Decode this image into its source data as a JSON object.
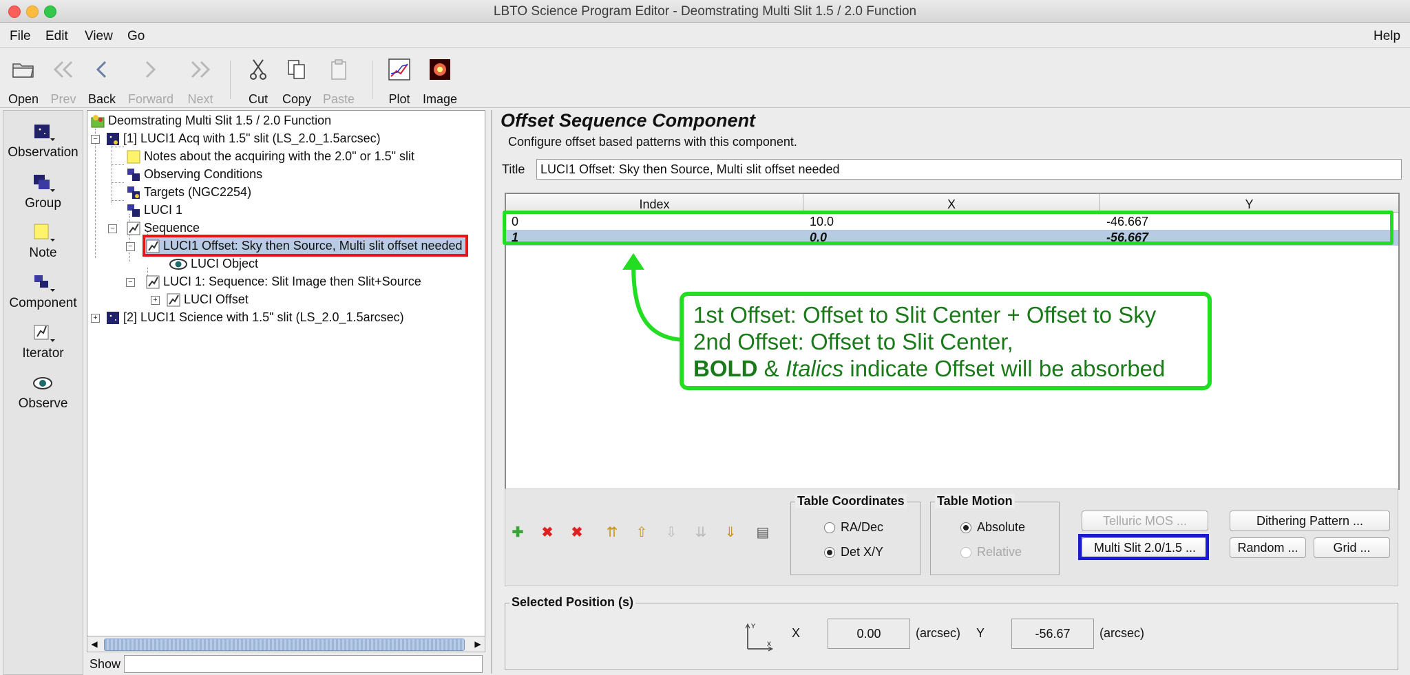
{
  "window": {
    "title": "LBTO Science Program Editor - Deomstrating Multi Slit 1.5 / 2.0 Function"
  },
  "menubar": {
    "file": "File",
    "edit": "Edit",
    "view": "View",
    "go": "Go",
    "help": "Help"
  },
  "toolbar": {
    "open": "Open",
    "prev": "Prev",
    "back": "Back",
    "forward": "Forward",
    "next": "Next",
    "cut": "Cut",
    "copy": "Copy",
    "paste": "Paste",
    "plot": "Plot",
    "image": "Image"
  },
  "palette": {
    "observation": "Observation",
    "group": "Group",
    "note": "Note",
    "component": "Component",
    "iterator": "Iterator",
    "observe": "Observe"
  },
  "tree": {
    "root": "Deomstrating Multi Slit 1.5 / 2.0 Function",
    "obs1": "[1] LUCI1 Acq with 1.5\" slit  (LS_2.0_1.5arcsec)",
    "notes": "Notes about the acquiring with the 2.0\" or 1.5\" slit",
    "conditions": "Observing Conditions",
    "targets": "Targets (NGC2254)",
    "luci1": "LUCI 1",
    "sequence": "Sequence",
    "offset_selected": "LUCI1 Offset: Sky then Source, Multi slit offset needed",
    "luci_object": "LUCI Object",
    "luci_seq": "LUCI 1: Sequence: Slit Image then Slit+Source",
    "luci_offset": "LUCI Offset",
    "obs2": "[2] LUCI1 Science with 1.5\" slit  (LS_2.0_1.5arcsec)",
    "show_label": "Show"
  },
  "component": {
    "header": "Offset Sequence Component",
    "description": "Configure offset based patterns with this component.",
    "title_label": "Title",
    "title_value": "LUCI1 Offset: Sky then Source, Multi slit offset needed"
  },
  "table": {
    "headers": [
      "Index",
      "X",
      "Y"
    ],
    "rows": [
      {
        "index": "0",
        "x": "10.0",
        "y": "-46.667"
      },
      {
        "index": "1",
        "x": "0.0",
        "y": "-56.667"
      }
    ]
  },
  "annotation": {
    "line1": "1st Offset: Offset to Slit Center + Offset to Sky",
    "line2": "2nd Offset: Offset to Slit Center,",
    "line3_bold": "BOLD",
    "line3_amp": " & ",
    "line3_italic": "Italics",
    "line3_rest": " indicate Offset will be absorbed",
    "box_color": "#22dd22",
    "text_color": "#1a7a1a"
  },
  "controls": {
    "table_coordinates": "Table Coordinates",
    "ra_dec": "RA/Dec",
    "det_xy": "Det X/Y",
    "table_motion": "Table Motion",
    "absolute": "Absolute",
    "relative": "Relative",
    "telluric_mos": "Telluric MOS ...",
    "multi_slit": "Multi Slit 2.0/1.5 ...",
    "dithering": "Dithering Pattern ...",
    "random": "Random ...",
    "grid": "Grid ..."
  },
  "selected": {
    "legend": "Selected Position (s)",
    "x_label": "X",
    "x_value": "0.00",
    "x_unit": "(arcsec)",
    "y_label": "Y",
    "y_value": "-56.67",
    "y_unit": "(arcsec)"
  },
  "colors": {
    "selection_row": "#b8cbe4",
    "red_highlight": "#e3161b",
    "blue_highlight": "#1a1ad0"
  }
}
